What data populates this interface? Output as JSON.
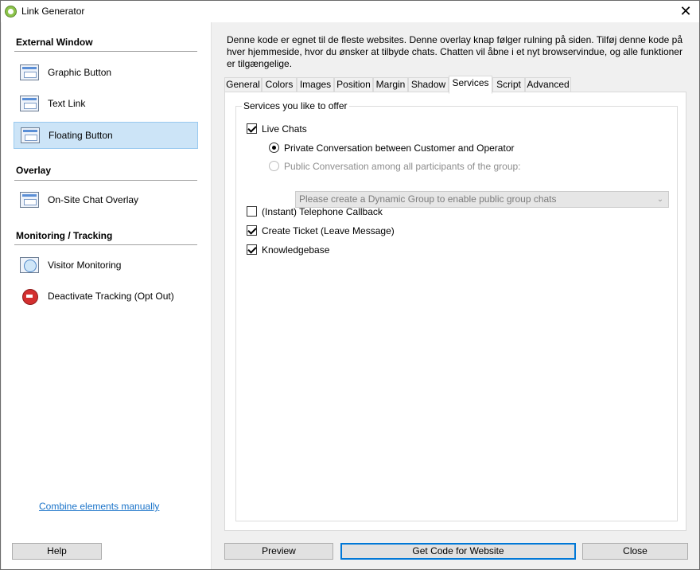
{
  "window": {
    "title": "Link Generator",
    "close_glyph": "✕",
    "app_icon": "app-gear-icon"
  },
  "sidebar": {
    "sections": [
      {
        "heading": "External Window"
      },
      {
        "heading": "Overlay"
      },
      {
        "heading": "Monitoring / Tracking"
      }
    ],
    "items": [
      {
        "label": "Graphic Button",
        "icon": "graphic-button-icon",
        "selected": false
      },
      {
        "label": "Text Link",
        "icon": "text-link-icon",
        "selected": false
      },
      {
        "label": "Floating Button",
        "icon": "floating-button-icon",
        "selected": true
      },
      {
        "label": "On-Site Chat Overlay",
        "icon": "chat-overlay-icon",
        "selected": false
      },
      {
        "label": "Visitor Monitoring",
        "icon": "visitor-monitoring-icon",
        "selected": false
      },
      {
        "label": "Deactivate Tracking (Opt Out)",
        "icon": "stop-icon",
        "selected": false
      }
    ],
    "combine_link": "Combine elements manually"
  },
  "description": "Denne kode er egnet til de fleste websites. Denne overlay knap følger rulning på siden. Tilføj denne kode på hver hjemmeside, hvor du ønsker at tilbyde chats. Chatten vil åbne i et nyt browservindue, og alle funktioner er tilgængelige.",
  "tabs": [
    {
      "label": "General",
      "active": false
    },
    {
      "label": "Colors",
      "active": false
    },
    {
      "label": "Images",
      "active": false
    },
    {
      "label": "Position",
      "active": false
    },
    {
      "label": "Margin",
      "active": false
    },
    {
      "label": "Shadow",
      "active": false
    },
    {
      "label": "Services",
      "active": true
    },
    {
      "label": "Script",
      "active": false
    },
    {
      "label": "Advanced",
      "active": false
    }
  ],
  "services": {
    "group_title": "Services you like to offer",
    "live_chats": {
      "label": "Live Chats",
      "checked": true
    },
    "private_conversation": {
      "label": "Private Conversation between Customer and Operator",
      "selected": true
    },
    "public_conversation": {
      "label": "Public Conversation among all participants of the group:",
      "selected": false,
      "disabled": true
    },
    "group_select": {
      "value": "Please create a Dynamic Group to enable public group chats",
      "disabled": true
    },
    "telephone_callback": {
      "label": "(Instant) Telephone Callback",
      "checked": false
    },
    "create_ticket": {
      "label": "Create Ticket (Leave Message)",
      "checked": true
    },
    "knowledgebase": {
      "label": "Knowledgebase",
      "checked": true
    }
  },
  "buttons": {
    "help": "Help",
    "preview": "Preview",
    "get_code": "Get Code for Website",
    "close": "Close"
  }
}
